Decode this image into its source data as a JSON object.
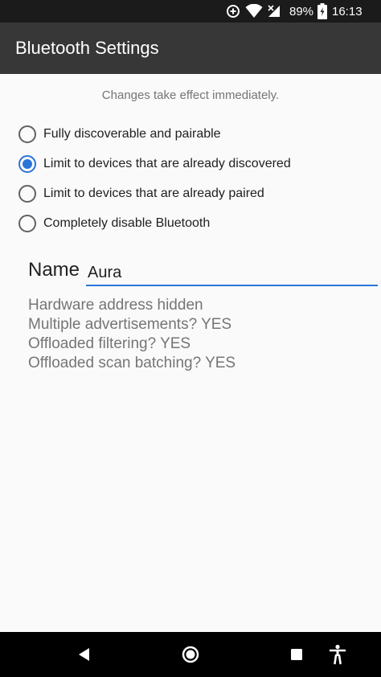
{
  "status_bar": {
    "battery_percent": "89%",
    "time": "16:13",
    "icons": [
      "data-saver-icon",
      "wifi-icon",
      "no-signal-icon",
      "battery-charging-icon"
    ]
  },
  "app_bar": {
    "title": "Bluetooth Settings"
  },
  "main": {
    "hint": "Changes take effect immediately.",
    "visibility_options": [
      {
        "label": "Fully discoverable and pairable",
        "selected": false
      },
      {
        "label": "Limit to devices that are already discovered",
        "selected": true
      },
      {
        "label": "Limit to devices that are already paired",
        "selected": false
      },
      {
        "label": "Completely disable Bluetooth",
        "selected": false
      }
    ],
    "name_label": "Name",
    "name_value": "Aura",
    "info_lines": [
      "Hardware address hidden",
      "Multiple advertisements? YES",
      "Offloaded filtering? YES",
      "Offloaded scan batching? YES"
    ]
  },
  "nav_bar": {
    "icons": [
      "back-icon",
      "home-icon",
      "recents-icon",
      "accessibility-icon"
    ]
  },
  "colors": {
    "accent": "#2a73d9",
    "app_bar": "#373737",
    "status_bar": "#1b1b1b",
    "background": "#fafafa"
  }
}
